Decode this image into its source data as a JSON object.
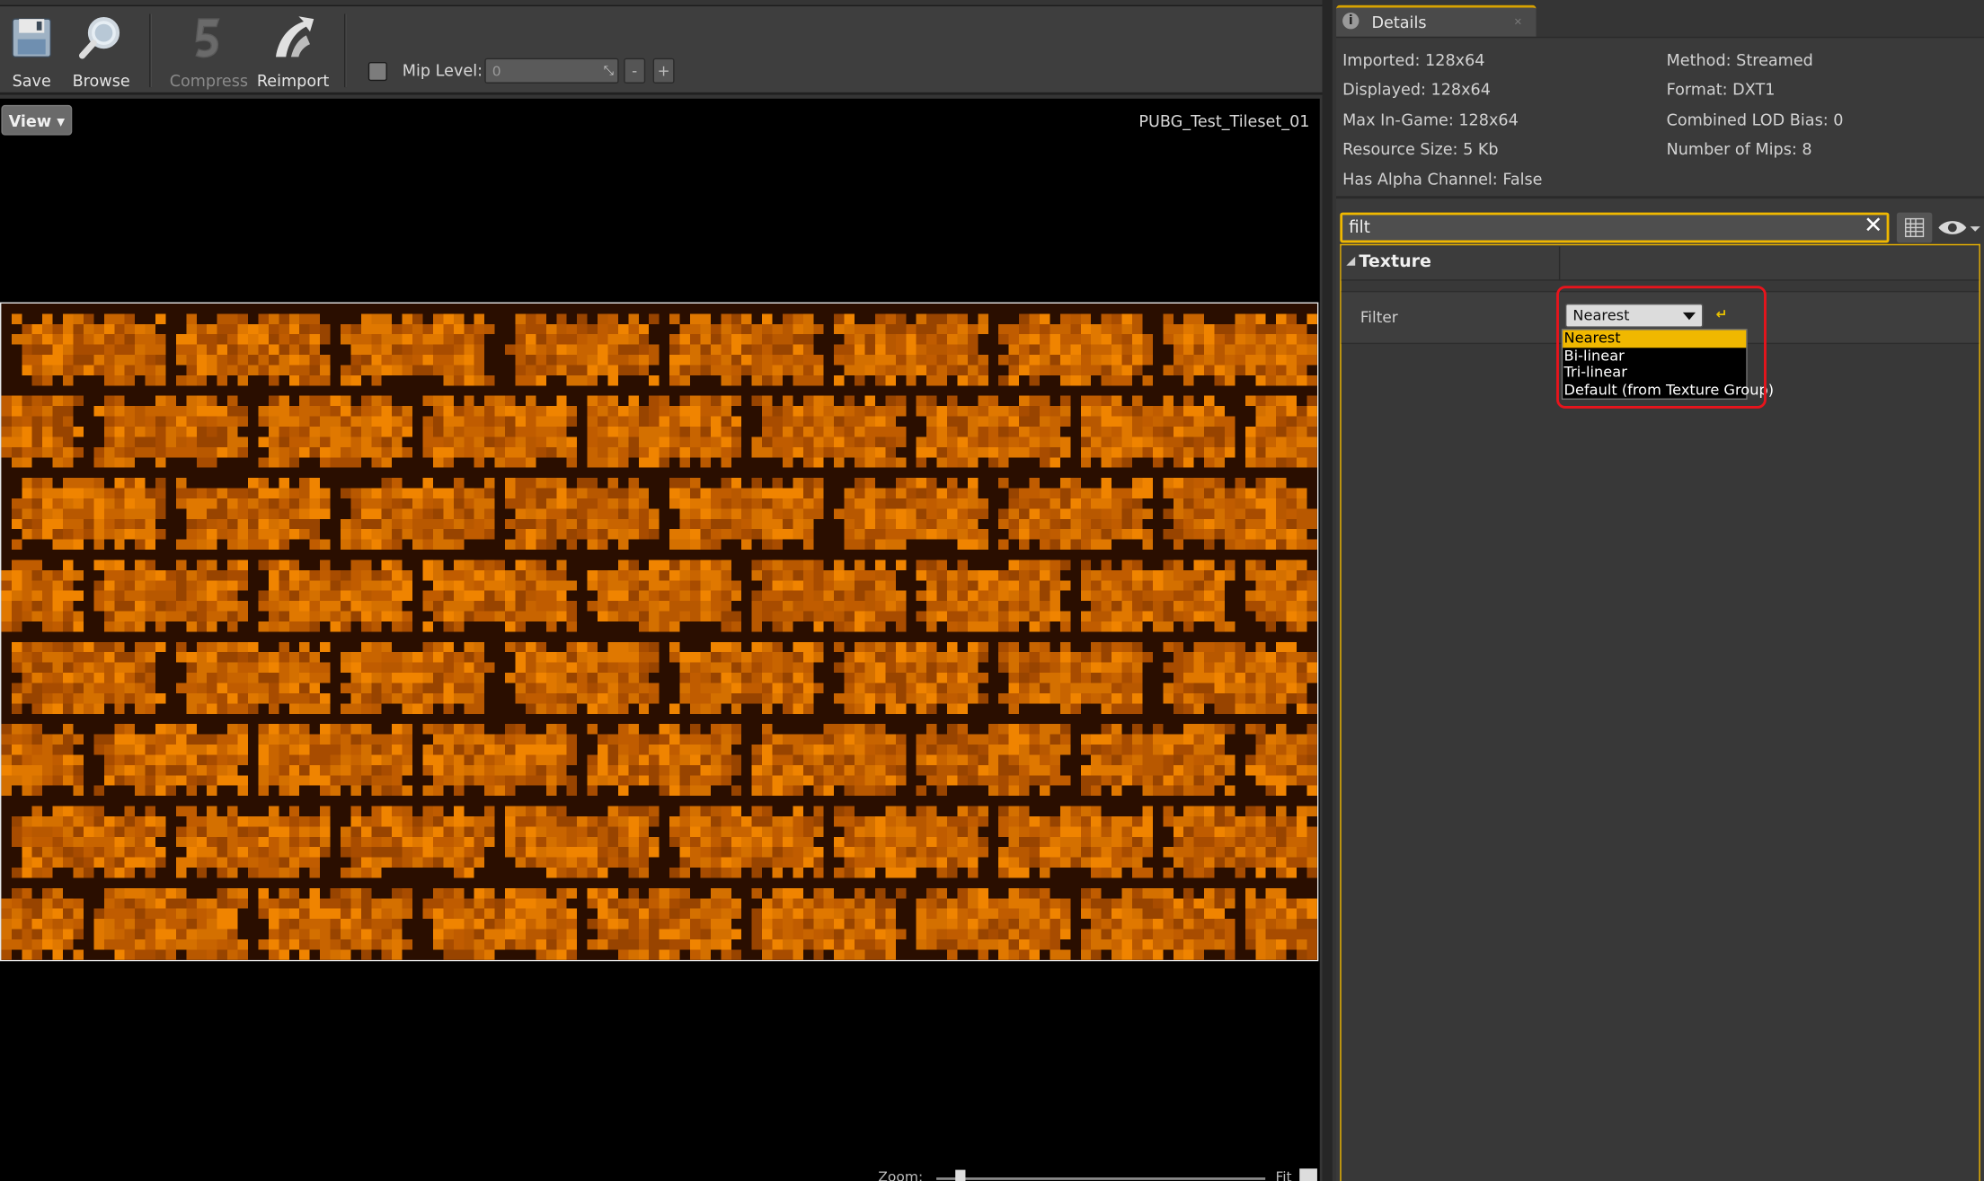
{
  "toolbar": {
    "save_label": "Save",
    "browse_label": "Browse",
    "compress_label": "Compress",
    "reimport_label": "Reimport",
    "mip_level_label": "Mip Level:",
    "mip_level_value": "0",
    "mip_decrement_label": "-",
    "mip_increment_label": "+"
  },
  "viewport": {
    "view_button_label": "View",
    "asset_name": "PUBG_Test_Tileset_01",
    "zoom_label": "Zoom:",
    "zoom_fit_label": "Fit"
  },
  "details": {
    "tab_title": "Details",
    "info_left": [
      "Imported: 128x64",
      "Displayed: 128x64",
      "Max In-Game: 128x64",
      "Resource Size: 5 Kb",
      "Has Alpha Channel: False"
    ],
    "info_right": [
      "Method: Streamed",
      "Format: DXT1",
      "Combined LOD Bias: 0",
      "Number of Mips: 8"
    ],
    "search_value": "filt",
    "category_label": "Texture",
    "property_label": "Filter",
    "filter_selected": "Nearest",
    "filter_options": [
      "Nearest",
      "Bi-linear",
      "Tri-linear",
      "Default (from Texture Group)"
    ]
  },
  "colors": {
    "accent": "#f0b800",
    "highlight": "#e8141c",
    "brick": "#c86400",
    "mortar": "#2a0e00"
  },
  "icons": [
    "save-icon",
    "browse-icon",
    "compress-icon",
    "reimport-icon",
    "info-icon",
    "close-icon",
    "grid-view-icon",
    "eye-icon",
    "reset-arrow-icon"
  ]
}
